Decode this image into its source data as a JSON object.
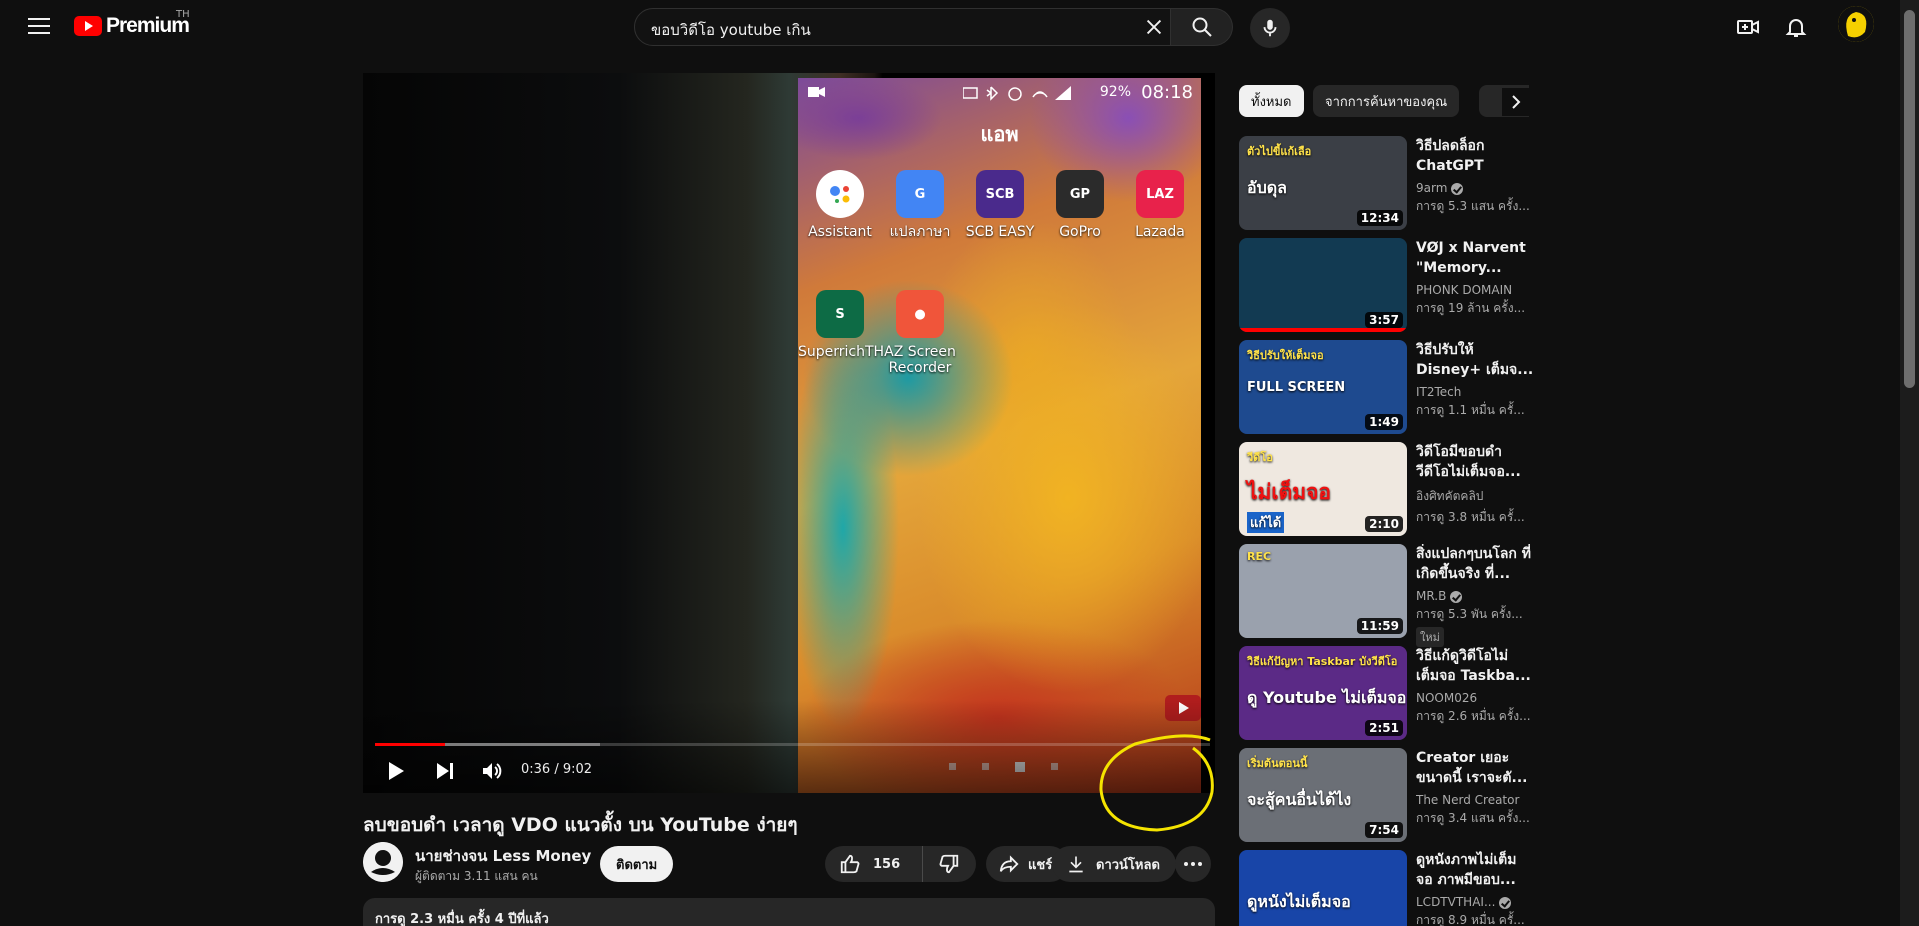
{
  "header": {
    "logo_text": "Premium",
    "country": "TH",
    "search_query": "ขอบวิดีโอ youtube เกิน"
  },
  "player": {
    "progress_fraction": 0.084,
    "buffer_fraction": 0.27,
    "time_display": "0:36 / 9:02",
    "phone": {
      "battery": "92%",
      "clock": "08:18",
      "screen_title": "แอพ",
      "apps": [
        {
          "label": "Assistant",
          "color": "#ffffff"
        },
        {
          "label": "แปลภาษา",
          "color": "#4285f4"
        },
        {
          "label": "SCB EASY",
          "color": "#4a2a8c"
        },
        {
          "label": "GoPro",
          "color": "#2b2b2b"
        },
        {
          "label": "Lazada",
          "color": "#e8224b"
        },
        {
          "label": "SuperrichTH",
          "color": "#0d6b45"
        },
        {
          "label": "AZ Screen Recorder",
          "color": "#f0553a"
        }
      ]
    }
  },
  "video": {
    "title": "ลบขอบดำ เวลาดู VDO แนวตั้ง บน YouTube ง่ายๆ",
    "channel_name": "นายช่างจน Less Money",
    "subscribers": "ผู้ติดตาม 3.11 แสน คน",
    "subscribe_label": "ติดตาม",
    "likes": "156",
    "share_label": "แชร์",
    "download_label": "ดาวน์โหลด",
    "description_meta": "การดู 2.3 หมื่น ครั้ง  4 ปีที่แล้ว"
  },
  "sidebar": {
    "chips": [
      "ทั้งหมด",
      "จากการค้นหาของคุณ"
    ],
    "recommendations": [
      {
        "title": "วิธีปลดล็อก ChatGPT",
        "channel": "9arm",
        "verified": true,
        "views": "การดู 5.3 แสน ครั้ง...",
        "duration": "12:34",
        "thumb_text": "อับดุล",
        "thumb_top": "ตัวไปขี้แก้เลือ",
        "bg": "#3b3f46"
      },
      {
        "title": "VØJ x Narvent \"Memory...",
        "channel": "PHONK DOMAIN",
        "verified": false,
        "views": "การดู 19 ล้าน ครั้ง...",
        "duration": "3:57",
        "watched": true,
        "bg": "#123a52"
      },
      {
        "title": "วิธีปรับให้ Disney+ เต็มจ...",
        "channel": "IT2Tech",
        "verified": false,
        "views": "การดู 1.1 หมื่น ครั้...",
        "duration": "1:49",
        "thumb_text": "FULL SCREEN",
        "thumb_top": "วิธีปรับให้เต็มจอ",
        "bg": "#1e4a8f"
      },
      {
        "title": "วิดีโอมีขอบดำ วีดีโอไม่เต็มจอ...",
        "channel": "อิงศิทคัตคลิป",
        "verified": false,
        "views": "การดู 3.8 หมื่น ครั้...",
        "duration": "2:10",
        "thumb_text": "ไม่เต็มจอ",
        "thumb_top": "วีดีโอ",
        "thumb_sub": "แก้ได้",
        "bg": "#efe8e0"
      },
      {
        "title": "สิ่งแปลกๆบนโลก ที่เกิดขึ้นจริง ที่...",
        "channel": "MR.B",
        "verified": true,
        "views": "การดู 5.3 พัน ครั้ง...",
        "duration": "11:59",
        "badge": "ใหม่",
        "thumb_top": "REC",
        "bg": "#9aa1ad"
      },
      {
        "title": "วิธีแก้ดูวิดีโอไม่ เต็มจอ Taskba...",
        "channel": "NOOM026",
        "verified": false,
        "views": "การดู 2.6 หมื่น ครั้ง...",
        "duration": "2:51",
        "thumb_text": "ดู Youtube ไม่เต็มจอ",
        "thumb_top": "วิธีแก้ปัญหา Taskbar บังวีดีโอ",
        "bg": "#5b2a86"
      },
      {
        "title": "Creator เยอะ ขนาดนี้ เราจะตั...",
        "channel": "The Nerd Creator",
        "verified": false,
        "views": "การดู 3.4 แสน ครั้ง...",
        "duration": "7:54",
        "thumb_text": "จะสู้คนอื่นได้ไง",
        "thumb_top": "เริ่มต้นตอนนี้",
        "bg": "#6b6f76"
      },
      {
        "title": "ดูหนังภาพไม่เต็ม จอ ภาพมีขอบ...",
        "channel": "LCDTVTHAI...",
        "verified": true,
        "views": "การดู 8.9 หมื่น ครั้...",
        "duration": "",
        "thumb_text": "ดูหนังไม่เต็มจอ",
        "bg": "#1845a8"
      }
    ]
  },
  "colors": {
    "accent": "#ff0000",
    "annotation": "#f5e400"
  }
}
